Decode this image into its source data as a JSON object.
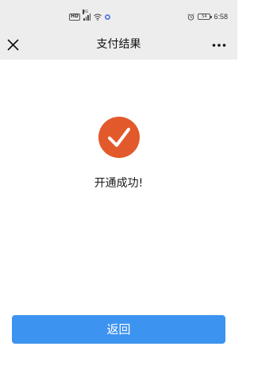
{
  "status_bar": {
    "hd_label": "HD",
    "network_label": "4G",
    "battery_level": "54",
    "time": "6:58",
    "icons": [
      "signal-icon",
      "wifi-icon",
      "notification-dot-icon",
      "alarm-icon",
      "battery-icon"
    ]
  },
  "nav": {
    "title": "支付结果",
    "close_icon": "close-icon",
    "more_icon": "more-icon"
  },
  "result": {
    "icon": "checkmark-icon",
    "icon_color": "#e25a2b",
    "message": "开通成功!"
  },
  "actions": {
    "back_label": "返回",
    "back_color": "#3d93f0"
  }
}
